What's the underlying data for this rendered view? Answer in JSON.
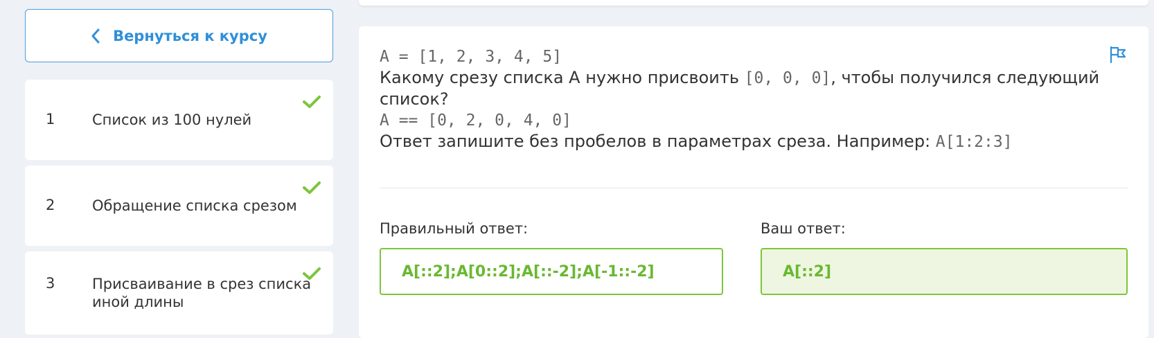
{
  "sidebar": {
    "back_label": "Вернуться к курсу",
    "lessons": [
      {
        "num": "1",
        "title": "Список из 100 нулей",
        "done": true
      },
      {
        "num": "2",
        "title": "Обращение списка срезом",
        "done": true
      },
      {
        "num": "3",
        "title": "Присваивание в срез списка иной длины",
        "done": true
      }
    ]
  },
  "question": {
    "line1_code": "A = [1, 2, 3, 4, 5]",
    "line2_text_before": "Какому срезу списка A нужно присвоить ",
    "line2_code": "[0, 0, 0]",
    "line2_text_after": ", чтобы получился следующий список?",
    "line3_code": "A == [0, 2, 0, 4, 0]",
    "line4_text": "Ответ запишите без пробелов в параметрах среза. Например: ",
    "line4_code": "A[1:2:3]"
  },
  "answers": {
    "correct_label": "Правильный ответ:",
    "correct_value": "A[::2];A[0::2];A[::-2];A[-1::-2]",
    "your_label": "Ваш ответ:",
    "your_value": "A[::2]"
  },
  "colors": {
    "accent_blue": "#2f8fd8",
    "success_green": "#7cc53b",
    "your_answer_bg": "#eef6e1"
  },
  "icons": {
    "back": "chevron-left-icon",
    "done": "check-icon",
    "report": "flag-icon"
  }
}
